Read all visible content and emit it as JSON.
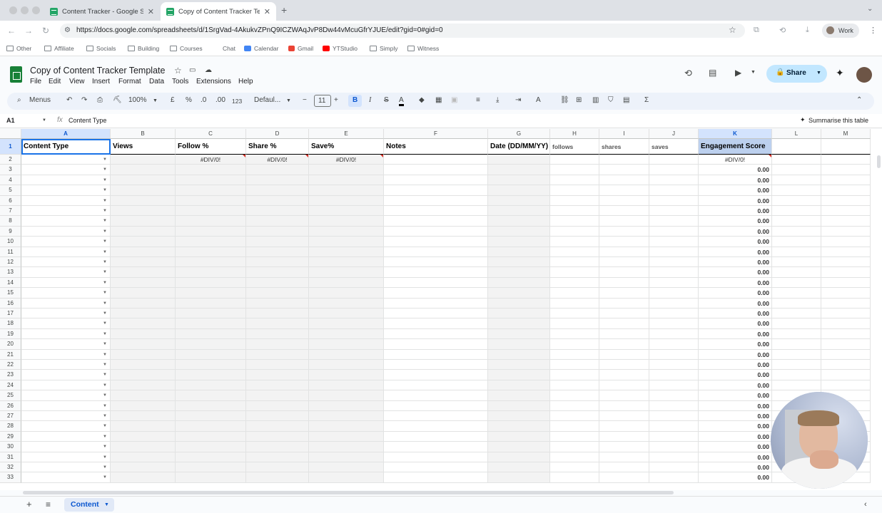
{
  "browser": {
    "tabs": [
      {
        "title": "Content Tracker - Google Sh",
        "active": false
      },
      {
        "title": "Copy of Content Tracker Tem",
        "active": true
      }
    ],
    "url": "https://docs.google.com/spreadsheets/d/1SrgVad-4AkukvZPnQ9ICZWAqJvP8Dw44vMcuGfrYJUE/edit?gid=0#gid=0",
    "profile_label": "Work",
    "bookmarks": [
      "Other",
      "Affiliate",
      "Socials",
      "Building",
      "Courses",
      "Chat",
      "Calendar",
      "Gmail",
      "YTStudio",
      "Simply",
      "Witness"
    ]
  },
  "sheets": {
    "doc_title": "Copy of Content Tracker Template",
    "menus": [
      "File",
      "Edit",
      "View",
      "Insert",
      "Format",
      "Data",
      "Tools",
      "Extensions",
      "Help"
    ],
    "share_label": "Share",
    "toolbar": {
      "menus_label": "Menus",
      "zoom": "100%",
      "currency": "£",
      "percent": "%",
      "dec_minus": ".0",
      "dec_plus": ".00",
      "number_format": "123",
      "font": "Defaul...",
      "font_size": "11",
      "bold": "B",
      "italic": "I",
      "sigma": "Σ"
    },
    "name_box": "A1",
    "formula": "Content Type",
    "summarise_label": "Summarise this table",
    "columns": [
      "A",
      "B",
      "C",
      "D",
      "E",
      "F",
      "G",
      "H",
      "I",
      "J",
      "K",
      "L",
      "M"
    ],
    "headers": {
      "A": "Content Type",
      "B": "Views",
      "C": "Follow %",
      "D": "Share %",
      "E": "Save%",
      "F": "Notes",
      "G": "Date (DD/MM/YY)",
      "H": "follows",
      "I": "shares",
      "J": "saves",
      "K": "Engagement Score"
    },
    "row_numbers": [
      "1",
      "2",
      "3",
      "4",
      "5",
      "6",
      "7",
      "8",
      "9",
      "10",
      "11",
      "12",
      "13",
      "14",
      "15",
      "16",
      "17",
      "18",
      "19",
      "20",
      "21",
      "22",
      "23",
      "24",
      "25",
      "26",
      "27",
      "28",
      "29",
      "30",
      "31",
      "32",
      "33"
    ],
    "error_value": "#DIV/0!",
    "score_value": "0.00",
    "sheet_tab": "Content"
  },
  "colors": {
    "accent": "#0b57d0",
    "share_bg": "#c2e7ff",
    "sheets_green": "#188038"
  }
}
